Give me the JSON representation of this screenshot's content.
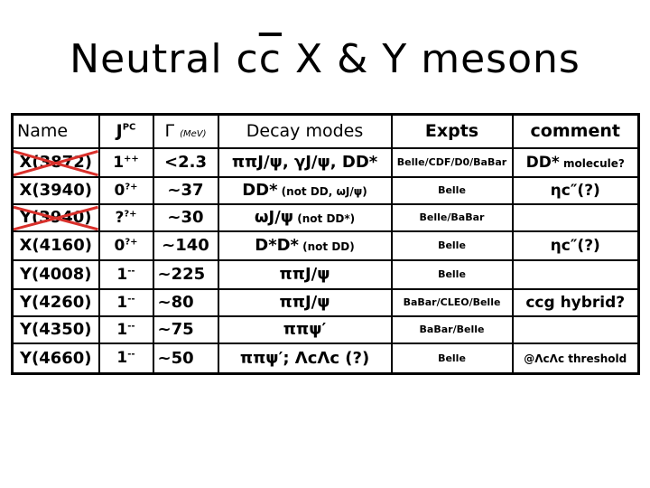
{
  "title": {
    "prefix": "Neutral c",
    "cbar": "c",
    "suffix": " X & Y mesons"
  },
  "colors": {
    "strike": "#d9302b",
    "text": "#000000",
    "background": "#ffffff"
  },
  "table": {
    "headers": {
      "name": "Name",
      "jpc_base": "J",
      "jpc_sup": "PC",
      "width_symbol": "Γ",
      "width_unit": "(MeV)",
      "decay": "Decay modes",
      "expts": "Expts",
      "comment": "comment"
    },
    "rows": [
      {
        "name": "X(3872)",
        "crossed_out": true,
        "jpc_base": "1",
        "jpc_sup": "++",
        "width": "<2.3",
        "decay_main": "ππJ/ψ, γJ/ψ, DD*",
        "decay_note": "",
        "expts": "Belle/CDF/D0/BaBar",
        "comment_main": "DD*",
        "comment_note": " molecule?"
      },
      {
        "name": "X(3940)",
        "crossed_out": false,
        "jpc_base": "0",
        "jpc_sup": "?+",
        "width": "~37",
        "decay_main": "DD*",
        "decay_note": " (not DD, ωJ/ψ)",
        "expts": "Belle",
        "comment_main": "ηc″(?)",
        "comment_note": ""
      },
      {
        "name": "Y(3940)",
        "crossed_out": true,
        "jpc_base": "?",
        "jpc_sup": "?+",
        "width": "~30",
        "decay_main": "ωJ/ψ",
        "decay_note": " (not DD*)",
        "expts": "Belle/BaBar",
        "comment_main": "",
        "comment_note": ""
      },
      {
        "name": "X(4160)",
        "crossed_out": false,
        "jpc_base": "0",
        "jpc_sup": "?+",
        "width": "~140",
        "decay_main": "D*D*",
        "decay_note": " (not DD)",
        "expts": "Belle",
        "comment_main": "ηc″(?)",
        "comment_note": ""
      },
      {
        "name": "Y(4008)",
        "crossed_out": false,
        "jpc_base": "1",
        "jpc_sup": "--",
        "width": "~225",
        "decay_main": "ππJ/ψ",
        "decay_note": "",
        "expts": "Belle",
        "comment_main": "",
        "comment_note": ""
      },
      {
        "name": "Y(4260)",
        "crossed_out": false,
        "jpc_base": "1",
        "jpc_sup": "--",
        "width": "~80",
        "decay_main": "ππJ/ψ",
        "decay_note": "",
        "expts": "BaBar/CLEO/Belle",
        "comment_main": "ccg hybrid?",
        "comment_note": ""
      },
      {
        "name": "Y(4350)",
        "crossed_out": false,
        "jpc_base": "1",
        "jpc_sup": "--",
        "width": "~75",
        "decay_main": "ππψ′",
        "decay_note": "",
        "expts": "BaBar/Belle",
        "comment_main": "",
        "comment_note": ""
      },
      {
        "name": "Y(4660)",
        "crossed_out": false,
        "jpc_base": "1",
        "jpc_sup": "--",
        "width": "~50",
        "decay_main": "ππψ′; ΛcΛc (?)",
        "decay_note": "",
        "expts": "Belle",
        "comment_main": "",
        "comment_note": "@ΛcΛc threshold"
      }
    ]
  }
}
